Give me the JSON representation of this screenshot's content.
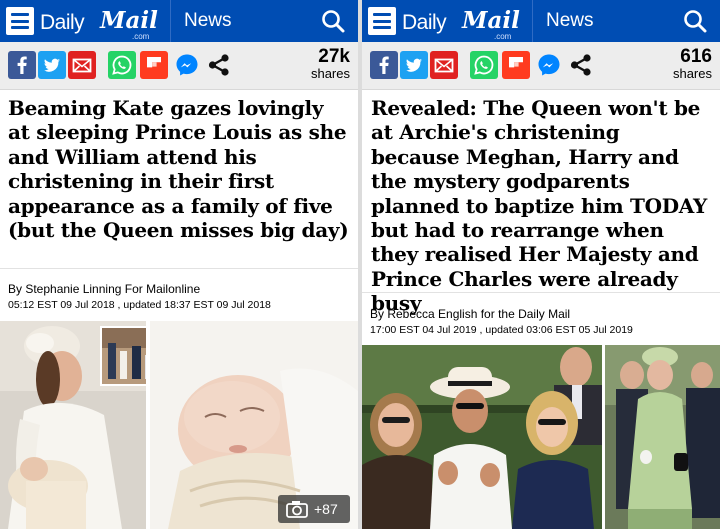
{
  "header": {
    "brand_daily": "Daily",
    "brand_mail": "Mail",
    "brand_com": ".com",
    "section": "News"
  },
  "colors": {
    "header_bg": "#004db3",
    "sharebar_bg": "#ededed",
    "facebook": "#3b5998",
    "twitter": "#1da1f2",
    "email": "#e02221",
    "whatsapp": "#25d366",
    "flipboard": "#ff3b1f"
  },
  "icons": [
    "menu-icon",
    "search-icon",
    "facebook-icon",
    "twitter-icon",
    "email-icon",
    "whatsapp-icon",
    "flipboard-icon",
    "messenger-icon",
    "share-icon",
    "camera-icon"
  ],
  "articles": [
    {
      "share_count": "27k",
      "share_label": "shares",
      "headline": "Beaming Kate gazes lovingly at sleeping Prince Louis as she and William attend his christening in their first appearance as a family of five (but the Queen misses big day)",
      "byline": "By Stephanie Linning For Mailonline",
      "dateline": "05:12 EST 09 Jul 2018 , updated 18:37 EST 09 Jul 2018",
      "gallery_count": "+87"
    },
    {
      "share_count": "616",
      "share_label": "shares",
      "headline": "Revealed: The Queen won't be at Archie's christening because Meghan, Harry and the mystery godparents planned to baptize him TODAY but had to rearrange when they realised Her Majesty and Prince Charles were already busy",
      "byline": "By Rebecca English for the Daily Mail",
      "dateline": "17:00 EST 04 Jul 2019 , updated 03:06 EST 05 Jul 2019"
    }
  ]
}
